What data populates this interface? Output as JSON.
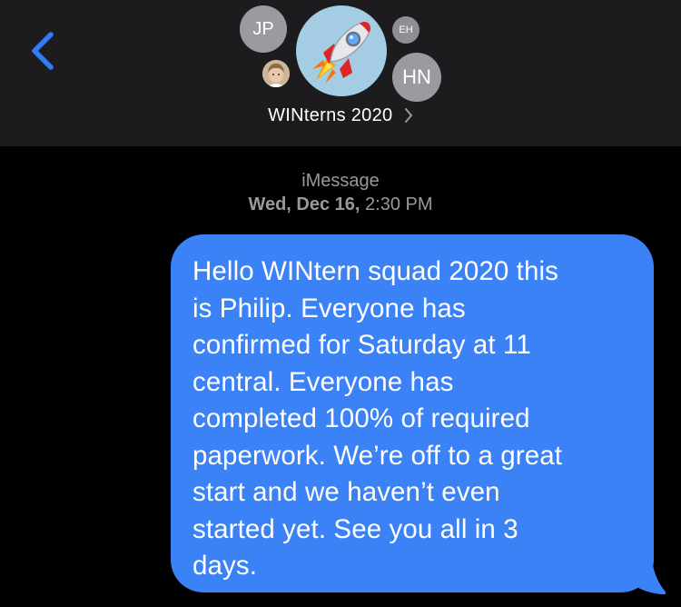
{
  "colors": {
    "header_bg": "#1c1c1e",
    "screen_bg": "#000000",
    "accent_blue": "#3b82f6",
    "back_chevron_blue": "#2f7cf6",
    "secondary_text": "#98989d",
    "avatar_gray": "#9a9aa0"
  },
  "header": {
    "back_icon": "chevron-left-icon",
    "group_name": "WINterns 2020",
    "group_chevron_icon": "chevron-right-icon",
    "avatars": [
      {
        "initials": "JP"
      },
      {
        "initials": "EH"
      },
      {
        "image": "profile-photo"
      },
      {
        "image": "rocket-emoji"
      },
      {
        "initials": "HN"
      }
    ]
  },
  "conversation": {
    "service": "iMessage",
    "timestamp_day": "Wed, Dec 16,",
    "timestamp_time": "2:30 PM",
    "messages": [
      {
        "sender": "me",
        "lines": [
          "Hello WINtern squad 2020 this",
          "is Philip. Everyone has",
          "confirmed for Saturday at 11",
          "central. Everyone has",
          "completed 100% of required",
          "paperwork. We’re off to a great",
          "start and we haven’t even",
          "started yet. See you all in 3",
          "days."
        ]
      }
    ]
  }
}
